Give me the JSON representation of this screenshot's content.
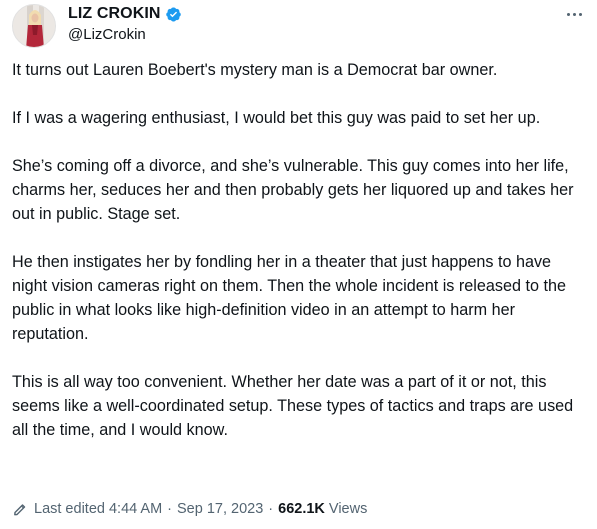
{
  "header": {
    "display_name": "LIZ CROKIN",
    "handle": "@LizCrokin",
    "verified_icon": "verified-badge-icon",
    "more_icon": "more-options-icon"
  },
  "tweet": {
    "paragraphs": [
      "It turns out Lauren Boebert's mystery man is a Democrat bar owner.",
      "If I was a wagering enthusiast, I would bet this guy was paid to set her up.",
      "She’s coming off a divorce, and she’s vulnerable. This guy comes into her life, charms her, seduces her and then probably gets her liquored up and takes her out in public. Stage set.",
      "He then instigates her by fondling her in a theater that just happens to have night vision cameras right on them.  Then the whole incident is released to the public in what looks like high-definition video in an attempt to harm her reputation.",
      "This is all way too convenient. Whether her date was a part of it or not, this seems like a well-coordinated setup. These types of tactics and traps are used all the time, and I would know."
    ]
  },
  "meta": {
    "edit_icon": "edit-pencil-icon",
    "edited_label": "Last edited 4:44 AM",
    "separator": "·",
    "date": "Sep 17, 2023",
    "views_count": "662.1K",
    "views_label": "Views"
  },
  "colors": {
    "text_primary": "#0f1419",
    "text_secondary": "#536471",
    "verified_blue": "#1d9bf0"
  }
}
